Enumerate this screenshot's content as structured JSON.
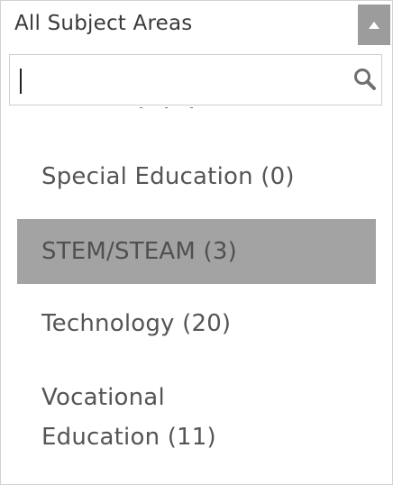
{
  "select": {
    "value": "All Subject Areas",
    "toggle_icon": "caret-up-icon"
  },
  "search": {
    "value": "",
    "placeholder": "",
    "icon": "search-icon"
  },
  "options": [
    {
      "label": "Special Education  (0)",
      "highlighted": false
    },
    {
      "label": "STEM/STEAM  (3)",
      "highlighted": true
    },
    {
      "label": "Technology  (20)",
      "highlighted": false
    },
    {
      "label_line1": "Vocational",
      "label_line2": "Education  (11)",
      "highlighted": false
    }
  ],
  "colors": {
    "highlight": "#a3a3a3",
    "toggle": "#9c9c9c",
    "text": "#555555"
  }
}
